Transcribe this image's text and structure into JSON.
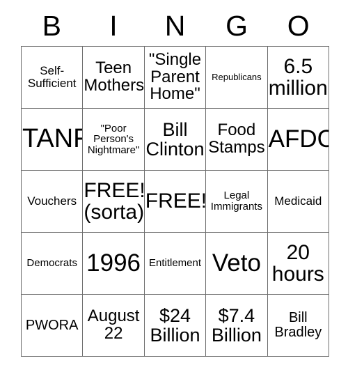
{
  "card": {
    "title": "BINGO",
    "header_letters": [
      "B",
      "I",
      "N",
      "G",
      "O"
    ],
    "colors": {
      "text": "#000000",
      "cell_background": "#ffffff",
      "border": "#6d6d6d",
      "page_background": "#ffffff"
    },
    "grid_size": "5x5",
    "rows": [
      [
        {
          "text": "Self-\nSufficient",
          "size": "fs-md"
        },
        {
          "text": "Teen\nMothers",
          "size": "fs-xl"
        },
        {
          "text": "\"Single\nParent\nHome\"",
          "size": "fs-xl"
        },
        {
          "text": "Republicans",
          "size": "fs-xs"
        },
        {
          "text": "6.5\nmillion",
          "size": "fs-3xl"
        }
      ],
      [
        {
          "text": "TANF",
          "size": "fs-5xl"
        },
        {
          "text": "\"Poor\nPerson's\nNightmare\"",
          "size": "fs-sm"
        },
        {
          "text": "Bill\nClinton",
          "size": "fs-2xl"
        },
        {
          "text": "Food\nStamps",
          "size": "fs-xl"
        },
        {
          "text": "AFDC",
          "size": "fs-4xl"
        }
      ],
      [
        {
          "text": "Vouchers",
          "size": "fs-md"
        },
        {
          "text": "FREE!\n(sorta)",
          "size": "fs-3xl"
        },
        {
          "text": "FREE!",
          "size": "fs-3xl"
        },
        {
          "text": "Legal\nImmigrants",
          "size": "fs-sm"
        },
        {
          "text": "Medicaid",
          "size": "fs-md"
        }
      ],
      [
        {
          "text": "Democrats",
          "size": "fs-sm"
        },
        {
          "text": "1996",
          "size": "fs-4xl"
        },
        {
          "text": "Entitlement",
          "size": "fs-sm"
        },
        {
          "text": "Veto",
          "size": "fs-4xl"
        },
        {
          "text": "20\nhours",
          "size": "fs-3xl"
        }
      ],
      [
        {
          "text": "PWORA",
          "size": "fs-lg"
        },
        {
          "text": "August\n22",
          "size": "fs-xl"
        },
        {
          "text": "$24\nBillion",
          "size": "fs-2xl"
        },
        {
          "text": "$7.4\nBillion",
          "size": "fs-2xl"
        },
        {
          "text": "Bill\nBradley",
          "size": "fs-lg"
        }
      ]
    ]
  }
}
